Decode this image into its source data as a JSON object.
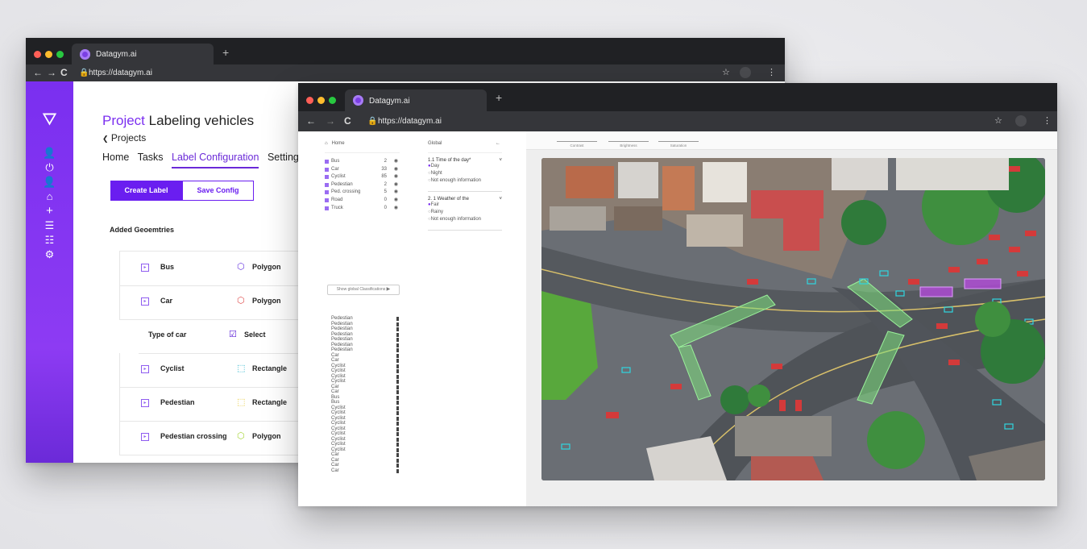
{
  "back_window": {
    "tab_title": "Datagym.ai",
    "url": "https://datagym.ai",
    "title_accent": "Project",
    "title_rest": "Labeling vehicles",
    "back_link": "Projects",
    "menu": [
      "Home",
      "Tasks",
      "Label Configuration",
      "Setting"
    ],
    "active_menu": "Label Configuration",
    "create_label": "Create Label",
    "save_config": "Save Config",
    "added_geometries": "Added Geoemtries",
    "geometries": [
      {
        "name": "Bus",
        "type": "Polygon",
        "sub": false,
        "shape_color": "#6a3be0"
      },
      {
        "name": "Car",
        "type": "Polygon",
        "sub": false,
        "shape_color": "#e05050"
      },
      {
        "name": "Type of car",
        "type": "Select",
        "sub": true,
        "shape_color": "#5b1fd6"
      },
      {
        "name": "Cyclist",
        "type": "Rectangle",
        "sub": false,
        "shape_color": "#1fb0c8"
      },
      {
        "name": "Pedestian",
        "type": "Rectangle",
        "sub": false,
        "shape_color": "#e6c833"
      },
      {
        "name": "Pedestian crossing",
        "type": "Polygon",
        "sub": false,
        "shape_color": "#a8d63c"
      }
    ]
  },
  "front_window": {
    "tab_title": "Datagym.ai",
    "url": "https://datagym.ai",
    "home": "Home",
    "labels": [
      {
        "name": "Bus",
        "count": "2"
      },
      {
        "name": "Car",
        "count": "33"
      },
      {
        "name": "Cyclist",
        "count": "85"
      },
      {
        "name": "Pedestian",
        "count": "2"
      },
      {
        "name": "Ped. crossing",
        "count": "5"
      },
      {
        "name": "Road",
        "count": "0"
      },
      {
        "name": "Truck",
        "count": "0"
      }
    ],
    "show_global": "Show global Classifications",
    "items": [
      "Pedestian",
      "Pedestian",
      "Pedestian",
      "Pedestian",
      "Pedestian",
      "Pedestian",
      "Pedestian",
      "Car",
      "Car",
      "Cyclist",
      "Cyclist",
      "Cyclist",
      "Cyclist",
      "Car",
      "Car",
      "Bus",
      "Bus",
      "Cyclist",
      "Cyclist",
      "Cyclist",
      "Cyclist",
      "Cyclist",
      "Cyclist",
      "Cyclist",
      "Cyclist",
      "Cyclist",
      "Car",
      "Car",
      "Car",
      "Car"
    ],
    "global": "Global",
    "questions": [
      {
        "q": "1.1 Time of the day*",
        "options": [
          "Day",
          "Night",
          "Not enough information"
        ]
      },
      {
        "q": "2. 1 Weather of the",
        "options": [
          "Fair",
          "Rainy",
          "Not enough information"
        ]
      }
    ],
    "sliders": [
      "Contrast",
      "Brightness",
      "Saturation"
    ]
  }
}
